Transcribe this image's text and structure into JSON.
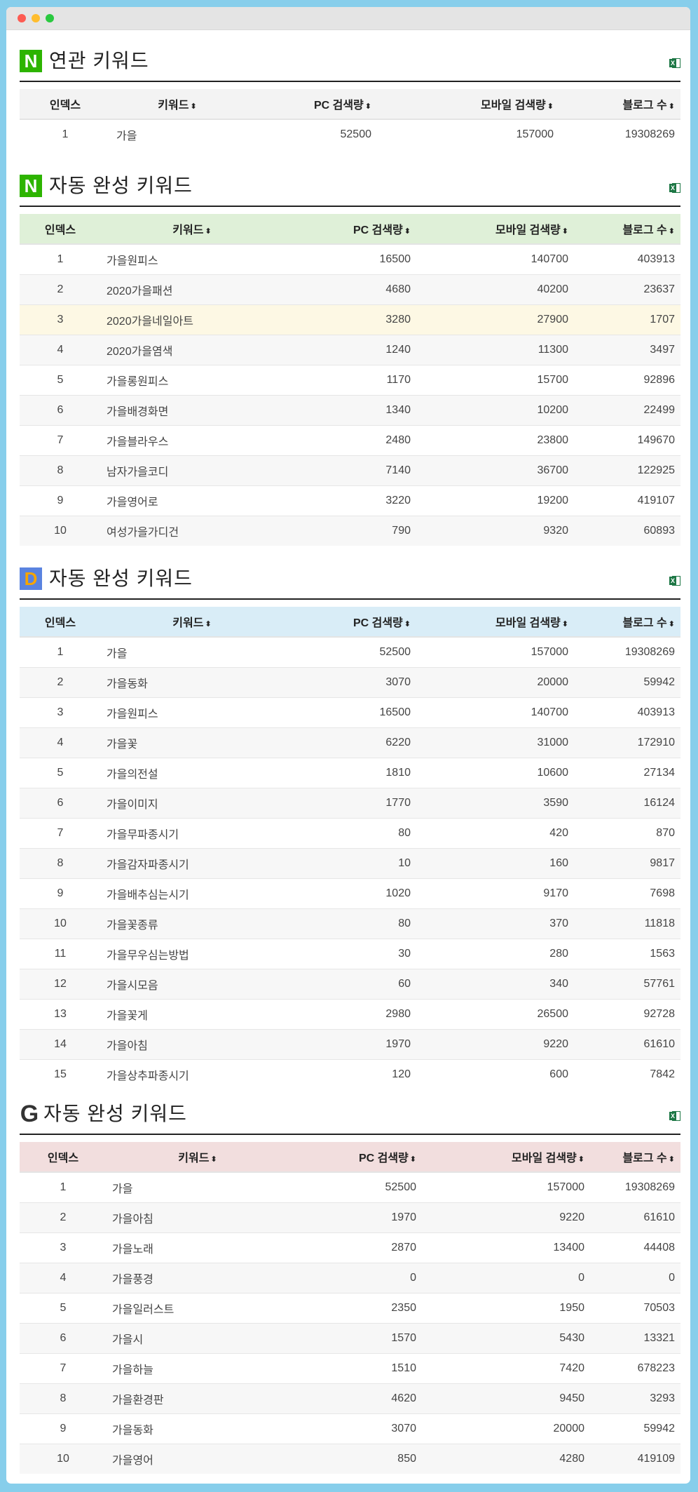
{
  "columns": {
    "index": "인덱스",
    "keyword": "키워드",
    "pc": "PC 검색량",
    "mobile": "모바일 검색량",
    "blog": "블로그 수",
    "sort_glyph": "⬍"
  },
  "sections": [
    {
      "title": "연관 키워드",
      "logo": "N",
      "rows": [
        [
          "1",
          "가을",
          "52500",
          "157000",
          "19308269"
        ]
      ]
    },
    {
      "title": "자동 완성 키워드",
      "logo": "N",
      "rows": [
        [
          "1",
          "가을원피스",
          "16500",
          "140700",
          "403913"
        ],
        [
          "2",
          "2020가을패션",
          "4680",
          "40200",
          "23637"
        ],
        [
          "3",
          "2020가을네일아트",
          "3280",
          "27900",
          "1707"
        ],
        [
          "4",
          "2020가을염색",
          "1240",
          "11300",
          "3497"
        ],
        [
          "5",
          "가을롱원피스",
          "1170",
          "15700",
          "92896"
        ],
        [
          "6",
          "가을배경화면",
          "1340",
          "10200",
          "22499"
        ],
        [
          "7",
          "가을블라우스",
          "2480",
          "23800",
          "149670"
        ],
        [
          "8",
          "남자가을코디",
          "7140",
          "36700",
          "122925"
        ],
        [
          "9",
          "가을영어로",
          "3220",
          "19200",
          "419107"
        ],
        [
          "10",
          "여성가을가디건",
          "790",
          "9320",
          "60893"
        ]
      ]
    },
    {
      "title": "자동 완성 키워드",
      "logo": "D",
      "rows": [
        [
          "1",
          "가을",
          "52500",
          "157000",
          "19308269"
        ],
        [
          "2",
          "가을동화",
          "3070",
          "20000",
          "59942"
        ],
        [
          "3",
          "가을원피스",
          "16500",
          "140700",
          "403913"
        ],
        [
          "4",
          "가을꽃",
          "6220",
          "31000",
          "172910"
        ],
        [
          "5",
          "가을의전설",
          "1810",
          "10600",
          "27134"
        ],
        [
          "6",
          "가을이미지",
          "1770",
          "3590",
          "16124"
        ],
        [
          "7",
          "가을무파종시기",
          "80",
          "420",
          "870"
        ],
        [
          "8",
          "가을감자파종시기",
          "10",
          "160",
          "9817"
        ],
        [
          "9",
          "가을배추심는시기",
          "1020",
          "9170",
          "7698"
        ],
        [
          "10",
          "가을꽃종류",
          "80",
          "370",
          "11818"
        ],
        [
          "11",
          "가을무우심는방법",
          "30",
          "280",
          "1563"
        ],
        [
          "12",
          "가을시모음",
          "60",
          "340",
          "57761"
        ],
        [
          "13",
          "가을꽃게",
          "2980",
          "26500",
          "92728"
        ],
        [
          "14",
          "가을아침",
          "1970",
          "9220",
          "61610"
        ],
        [
          "15",
          "가을상추파종시기",
          "120",
          "600",
          "7842"
        ]
      ]
    },
    {
      "title": "자동 완성 키워드",
      "logo": "G",
      "rows": [
        [
          "1",
          "가을",
          "52500",
          "157000",
          "19308269"
        ],
        [
          "2",
          "가을아침",
          "1970",
          "9220",
          "61610"
        ],
        [
          "3",
          "가을노래",
          "2870",
          "13400",
          "44408"
        ],
        [
          "4",
          "가을풍경",
          "0",
          "0",
          "0"
        ],
        [
          "5",
          "가을일러스트",
          "2350",
          "1950",
          "70503"
        ],
        [
          "6",
          "가을시",
          "1570",
          "5430",
          "13321"
        ],
        [
          "7",
          "가을하늘",
          "1510",
          "7420",
          "678223"
        ],
        [
          "8",
          "가을환경판",
          "4620",
          "9450",
          "3293"
        ],
        [
          "9",
          "가을동화",
          "3070",
          "20000",
          "59942"
        ],
        [
          "10",
          "가을영어",
          "850",
          "4280",
          "419109"
        ]
      ]
    }
  ],
  "colors": {
    "naver_green": "#2db400",
    "daum_blue": "#5a83e0",
    "header_green": "#dff0d8",
    "header_blue": "#d9edf7",
    "header_red": "#f2dede",
    "highlight_row": "#fdf8e4",
    "excel_green": "#1d7745"
  },
  "icons": {
    "excel": "excel-download-icon",
    "sort": "sort-icon"
  }
}
